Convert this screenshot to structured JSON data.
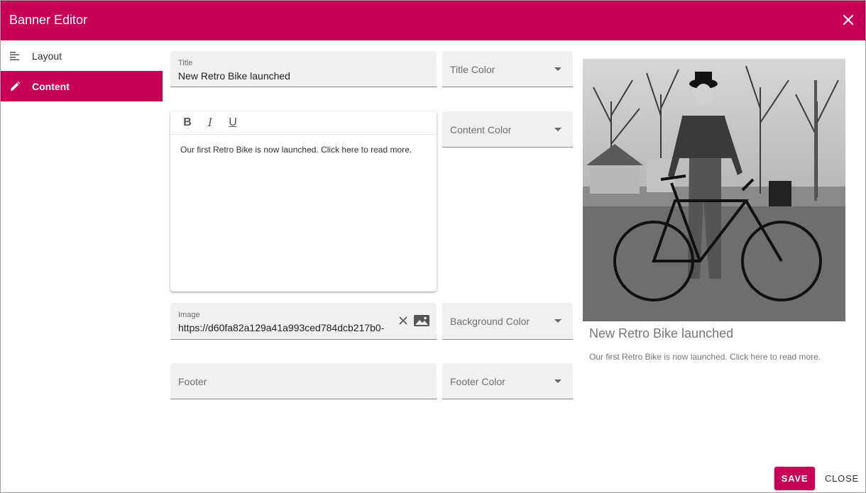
{
  "dialog": {
    "title": "Banner Editor",
    "accent_color": "#c70055",
    "close_icon": "close-icon"
  },
  "sidebar": {
    "items": [
      {
        "label": "Layout",
        "icon": "layout-icon",
        "active": false
      },
      {
        "label": "Content",
        "icon": "pencil-icon",
        "active": true
      }
    ]
  },
  "form": {
    "title": {
      "label": "Title",
      "value": "New Retro Bike launched"
    },
    "title_color": {
      "placeholder": "Title Color"
    },
    "content_color": {
      "placeholder": "Content Color"
    },
    "editor": {
      "toolbar": {
        "bold": "B",
        "italic": "I",
        "underline": "U"
      },
      "text": "Our first Retro Bike is now launched. Click here to read more."
    },
    "image": {
      "label": "Image",
      "value": "https://d60fa82a129a41a993ced784dcb217b0-"
    },
    "background_color": {
      "placeholder": "Background Color"
    },
    "footer": {
      "placeholder": "Footer"
    },
    "footer_color": {
      "placeholder": "Footer Color"
    }
  },
  "preview": {
    "image_alt": "man with retro bicycle",
    "title": "New Retro Bike launched",
    "content": "Our first Retro Bike is now launched. Click here to read more."
  },
  "actions": {
    "save_label": "SAVE",
    "close_label": "CLOSE"
  }
}
